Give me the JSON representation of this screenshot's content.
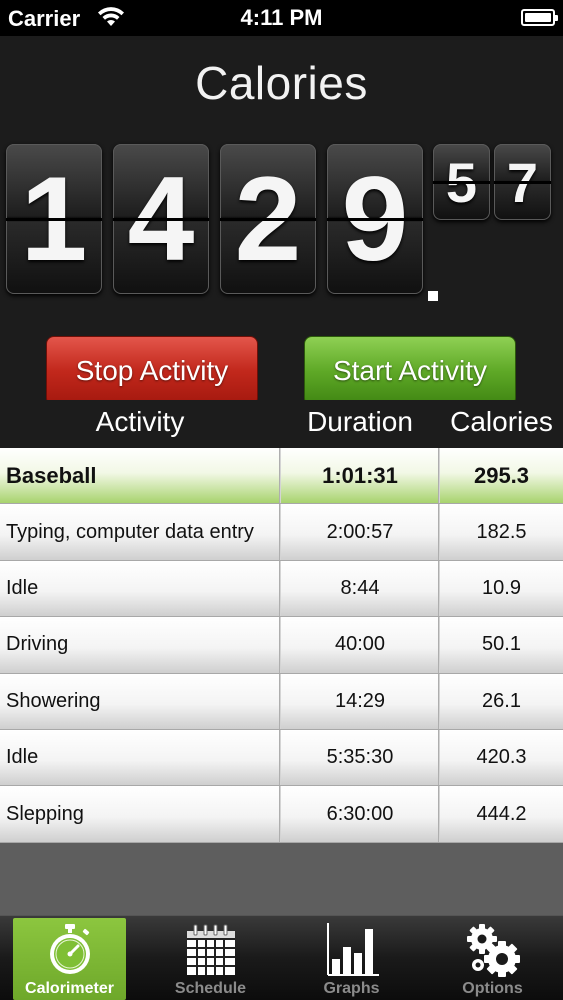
{
  "status": {
    "carrier": "Carrier",
    "time": "4:11 PM"
  },
  "counter": {
    "title": "Calories",
    "digits": [
      "1",
      "4",
      "2",
      "9"
    ],
    "decimals": [
      "5",
      "7"
    ]
  },
  "buttons": {
    "stop": "Stop Activity",
    "start": "Start Activity"
  },
  "table": {
    "headers": {
      "activity": "Activity",
      "duration": "Duration",
      "calories": "Calories"
    },
    "rows": [
      {
        "activity": "Baseball",
        "duration": "1:01:31",
        "calories": "295.3",
        "active": true
      },
      {
        "activity": "Typing, computer data entry",
        "duration": "2:00:57",
        "calories": "182.5"
      },
      {
        "activity": "Idle",
        "duration": "8:44",
        "calories": "10.9"
      },
      {
        "activity": "Driving",
        "duration": "40:00",
        "calories": "50.1"
      },
      {
        "activity": "Showering",
        "duration": "14:29",
        "calories": "26.1"
      },
      {
        "activity": "Idle",
        "duration": "5:35:30",
        "calories": "420.3"
      },
      {
        "activity": "Slepping",
        "duration": "6:30:00",
        "calories": "444.2"
      }
    ]
  },
  "tabs": [
    {
      "label": "Calorimeter",
      "icon": "stopwatch-icon",
      "selected": true
    },
    {
      "label": "Schedule",
      "icon": "calendar-icon"
    },
    {
      "label": "Graphs",
      "icon": "bar-chart-icon"
    },
    {
      "label": "Options",
      "icon": "gears-icon"
    }
  ],
  "colors": {
    "accent_green": "#8cc63f",
    "stop_red": "#c2281c",
    "start_green": "#5fa927"
  }
}
